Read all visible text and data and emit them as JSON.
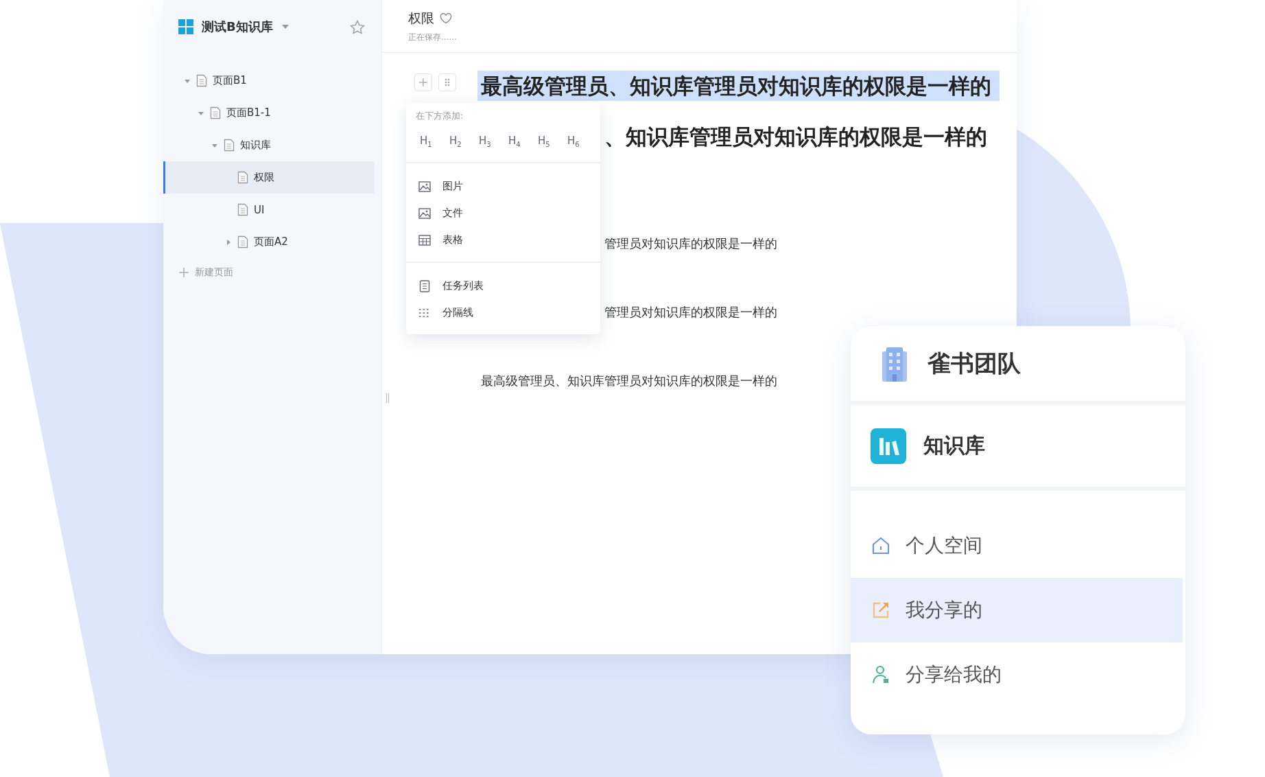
{
  "sidebar": {
    "title": "测试B知识库",
    "tree": [
      {
        "label": "页面B1",
        "expanded": true,
        "selected": false,
        "children": [
          {
            "label": "页面B1-1",
            "expanded": true,
            "selected": false,
            "children": [
              {
                "label": "知识库",
                "expanded": true,
                "selected": false,
                "children": [
                  {
                    "label": "权限",
                    "selected": true
                  },
                  {
                    "label": "UI",
                    "selected": false
                  },
                  {
                    "label": "页面A2",
                    "expanded": false,
                    "selected": false
                  }
                ]
              }
            ]
          }
        ]
      }
    ],
    "new_page": "新建页面"
  },
  "document": {
    "title": "权限",
    "favorite": false,
    "status": "正在保存......",
    "blocks": [
      {
        "kind": "heading",
        "text": "最高级管理员、知识库管理员对知识库的权限是一样的",
        "selected": true,
        "covered": false
      },
      {
        "kind": "heading",
        "text": "、知识库管理员对知识库的权限是一样的",
        "selected": false,
        "covered": true
      },
      {
        "kind": "paragraph",
        "text": "管理员对知识库的权限是一样的",
        "selected": false,
        "covered": true
      },
      {
        "kind": "paragraph",
        "text": "管理员对知识库的权限是一样的",
        "selected": false,
        "covered": true
      },
      {
        "kind": "paragraph",
        "text": "最高级管理员、知识库管理员对知识库的权限是一样的",
        "selected": false,
        "covered": false
      }
    ]
  },
  "insert_menu": {
    "label": "在下方添加:",
    "headings": [
      "H$_{1}$",
      "H$_{2}$",
      "H$_{3}$",
      "H$_{4}$",
      "H$_{5}$",
      "H$_{6}$"
    ],
    "groups": [
      [
        {
          "kind": "image",
          "label": "图片"
        },
        {
          "kind": "image",
          "label": "文件"
        },
        {
          "kind": "table",
          "label": "表格"
        }
      ],
      [
        {
          "kind": "list",
          "label": "任务列表"
        },
        {
          "kind": "divider",
          "label": "分隔线"
        }
      ]
    ]
  },
  "team_card": {
    "team": "雀书团队",
    "app": "知识库",
    "nav": [
      {
        "kind": "home",
        "label": "个人空间",
        "selected": false
      },
      {
        "kind": "share",
        "label": "我分享的",
        "selected": true
      },
      {
        "kind": "person",
        "label": "分享给我的",
        "selected": false
      }
    ]
  }
}
